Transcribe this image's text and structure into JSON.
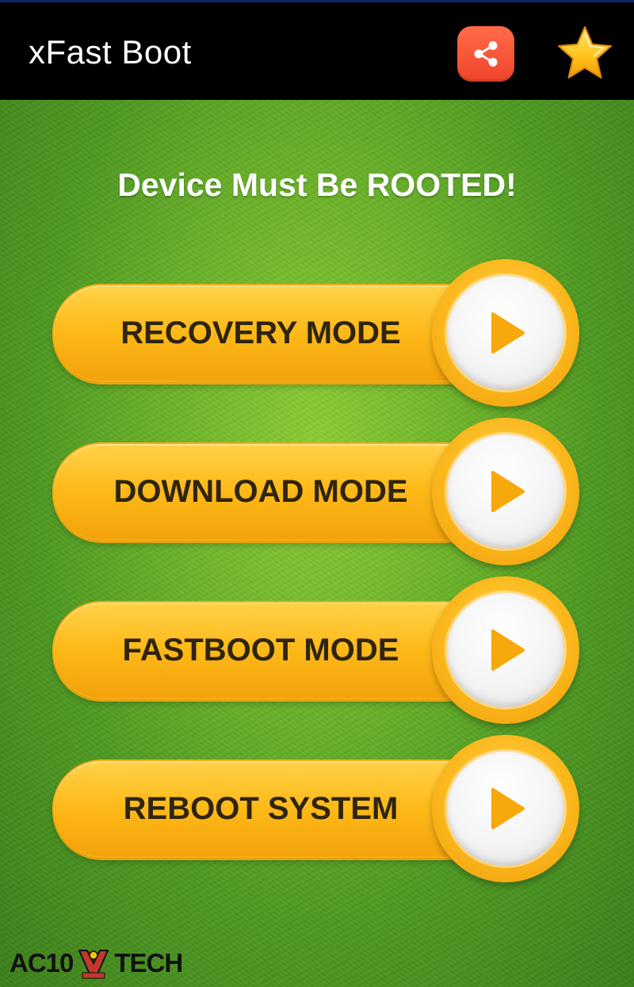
{
  "app": {
    "title": "xFast Boot",
    "share_icon": "share-icon",
    "star_icon": "star-icon",
    "accent": "#fbb71c",
    "appbar_color": "#000000",
    "share_color": "#f0452a"
  },
  "main": {
    "warning": "Device Must Be ROOTED!",
    "buttons": [
      {
        "label": "RECOVERY MODE",
        "icon": "play-icon"
      },
      {
        "label": "DOWNLOAD MODE",
        "icon": "play-icon"
      },
      {
        "label": "FASTBOOT MODE",
        "icon": "play-icon"
      },
      {
        "label": "REBOOT SYSTEM",
        "icon": "play-icon"
      }
    ]
  },
  "watermark": {
    "left": "AC10",
    "right": "TECH"
  }
}
